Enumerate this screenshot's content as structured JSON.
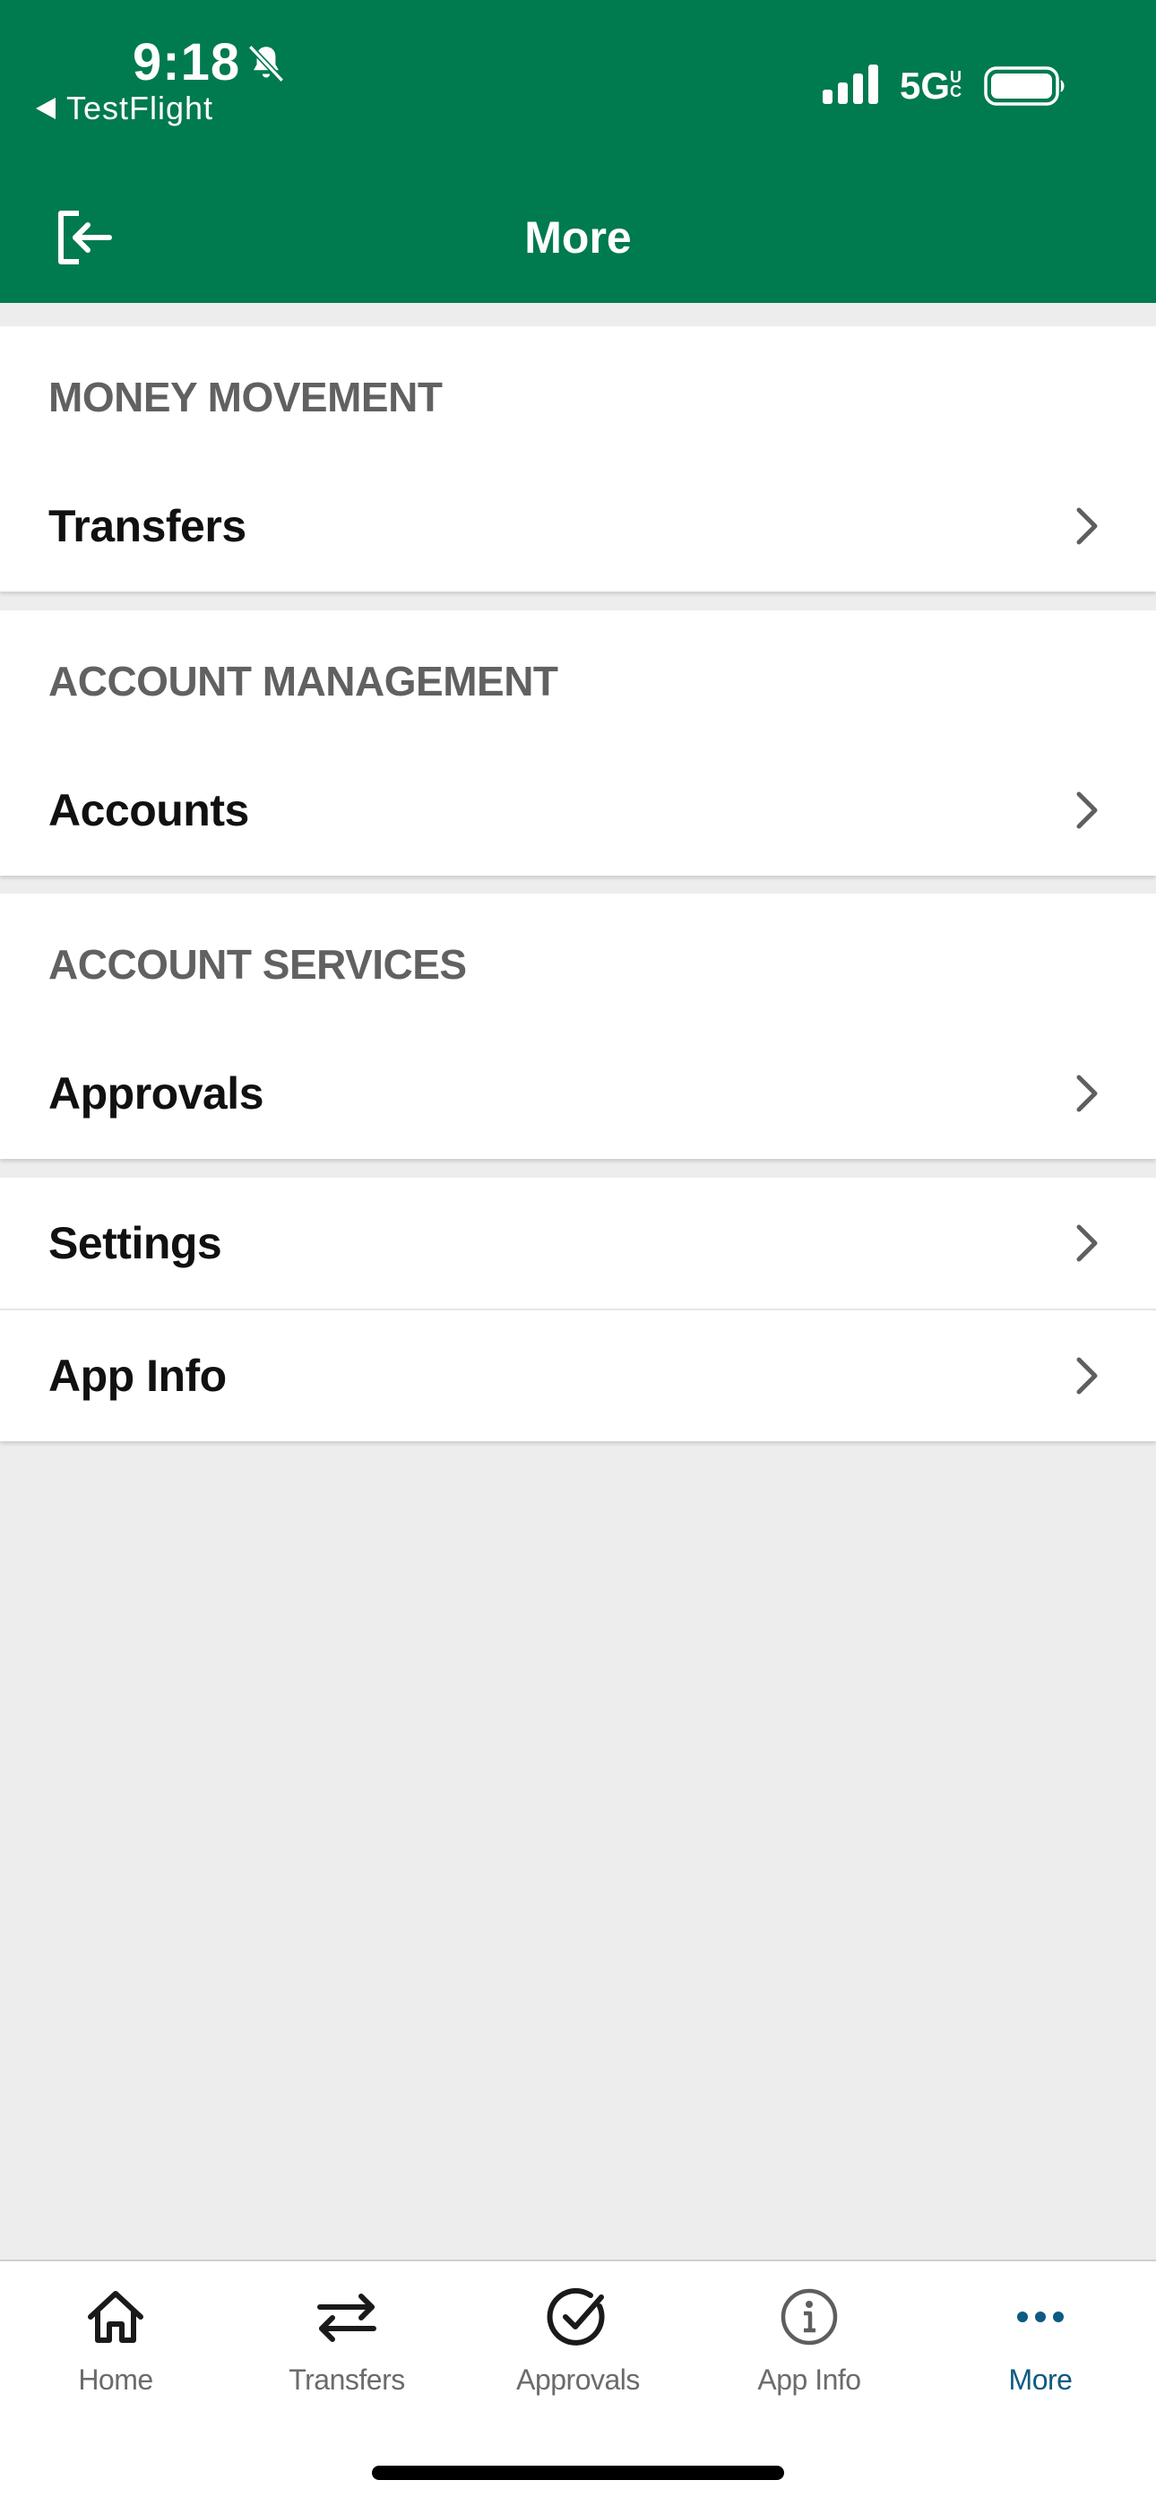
{
  "status_bar": {
    "time": "9:18",
    "back_app": "TestFlight",
    "network": "5G",
    "network_suffix": "UC",
    "icons": [
      "bell-muted-icon",
      "signal-icon",
      "battery-icon"
    ]
  },
  "header": {
    "title": "More",
    "exit_icon": "logout-icon",
    "background_color": "#007a4f"
  },
  "sections": [
    {
      "title": "MONEY MOVEMENT",
      "items": [
        {
          "label": "Transfers"
        }
      ]
    },
    {
      "title": "ACCOUNT MANAGEMENT",
      "items": [
        {
          "label": "Accounts"
        }
      ]
    },
    {
      "title": "ACCOUNT SERVICES",
      "items": [
        {
          "label": "Approvals"
        }
      ]
    },
    {
      "title": "",
      "items": [
        {
          "label": "Settings"
        },
        {
          "label": "App Info"
        }
      ]
    }
  ],
  "tabbar": {
    "tabs": [
      {
        "label": "Home",
        "icon": "home-icon"
      },
      {
        "label": "Transfers",
        "icon": "transfer-arrows-icon"
      },
      {
        "label": "Approvals",
        "icon": "check-circle-icon"
      },
      {
        "label": "App Info",
        "icon": "info-circle-icon"
      },
      {
        "label": "More",
        "icon": "more-dots-icon"
      }
    ],
    "active_tab": "More",
    "active_color": "#0d5a82"
  }
}
